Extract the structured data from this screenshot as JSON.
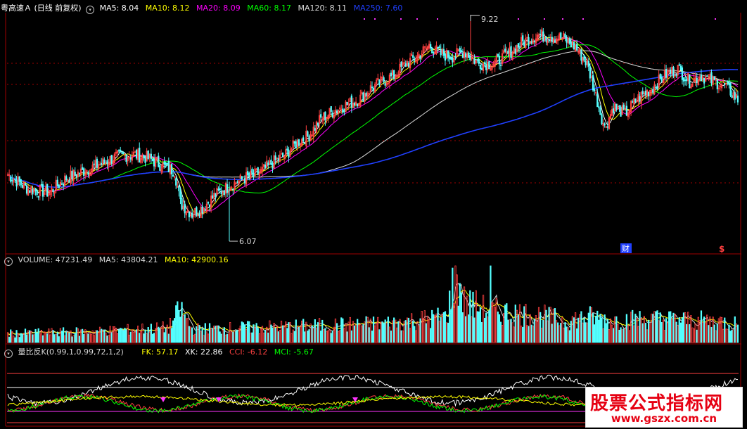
{
  "colors": {
    "background": "#000000",
    "border": "#a00000",
    "up": "#ff4040",
    "down": "#54ffff",
    "ma5": "#ffffff",
    "ma10": "#ffff00",
    "ma20": "#ff00ff",
    "ma60": "#00ff00",
    "ma120": "#dcdcdc",
    "ma250": "#2040ff",
    "label_white": "#d8d8d8",
    "cci": "#ff4040",
    "mci": "#00ff00",
    "fk": "#ffff00",
    "xk": "#ffffff",
    "marker": "#ff33ff"
  },
  "price_panel": {
    "title": "粤高速Ａ (日线 前复权)",
    "collapse_icon": "circle-chevron-icon",
    "indicators": [
      {
        "label": "MA5: 8.04",
        "color": "#ffffff"
      },
      {
        "label": "MA10: 8.12",
        "color": "#ffff00"
      },
      {
        "label": "MA20: 8.09",
        "color": "#ff00ff"
      },
      {
        "label": "MA60: 8.17",
        "color": "#00ff00"
      },
      {
        "label": "MA120: 8.11",
        "color": "#dcdcdc"
      },
      {
        "label": "MA250: 7.60",
        "color": "#2040ff"
      }
    ],
    "high_label": "9.22",
    "low_label": "6.07",
    "markers": [
      {
        "text": "财",
        "color": "#ffffff",
        "bg": "#2040ff"
      },
      {
        "text": "$",
        "color": "#ff4040",
        "bg": ""
      }
    ]
  },
  "volume_panel": {
    "collapse_icon": "circle-chevron-icon",
    "indicators": [
      {
        "label": "VOLUME: 47231.49",
        "color": "#d8d8d8"
      },
      {
        "label": "MA5: 43804.21",
        "color": "#d8d8d8"
      },
      {
        "label": "MA10: 42900.16",
        "color": "#ffff00"
      }
    ]
  },
  "indicator_panel": {
    "title": "量比反K(0.99,1,0.99,72,1,2)",
    "collapse_icon": "circle-chevron-icon",
    "indicators": [
      {
        "label": "FK: 57.17",
        "color": "#ffff00"
      },
      {
        "label": "XK: 22.86",
        "color": "#ffffff"
      },
      {
        "label": "CCI: -6.12",
        "color": "#ff4040"
      },
      {
        "label": "MCI: -5.67",
        "color": "#00ff00"
      }
    ]
  },
  "watermark": {
    "main": "股票公式指标网",
    "url": "www.gszx.com.cn"
  },
  "chart_data": {
    "type": "candlestick",
    "title": "粤高速Ａ (日线 前复权)",
    "price_range": [
      6.07,
      9.22
    ],
    "price_high_label": 9.22,
    "price_low_label": 6.07,
    "last_values": {
      "MA5": 8.04,
      "MA10": 8.12,
      "MA20": 8.09,
      "MA60": 8.17,
      "MA120": 8.11,
      "MA250": 7.6,
      "VOLUME": 47231.49,
      "VOL_MA5": 43804.21,
      "VOL_MA10": 42900.16,
      "FK": 57.17,
      "XK": 22.86,
      "CCI": -6.12,
      "MCI": -5.67
    },
    "close_path": [
      [
        0,
        7.0
      ],
      [
        14,
        6.8
      ],
      [
        28,
        6.75
      ],
      [
        40,
        6.95
      ],
      [
        52,
        7.05
      ],
      [
        64,
        7.15
      ],
      [
        74,
        7.25
      ],
      [
        86,
        7.28
      ],
      [
        96,
        7.23
      ],
      [
        106,
        7.12
      ],
      [
        114,
        7.05
      ],
      [
        118,
        6.6
      ],
      [
        126,
        6.45
      ],
      [
        134,
        6.55
      ],
      [
        142,
        6.72
      ],
      [
        152,
        6.85
      ],
      [
        162,
        6.95
      ],
      [
        172,
        7.02
      ],
      [
        182,
        7.18
      ],
      [
        190,
        7.28
      ],
      [
        198,
        7.45
      ],
      [
        206,
        7.55
      ],
      [
        214,
        7.78
      ],
      [
        222,
        7.88
      ],
      [
        232,
        7.98
      ],
      [
        240,
        8.05
      ],
      [
        248,
        8.2
      ],
      [
        256,
        8.3
      ],
      [
        264,
        8.38
      ],
      [
        272,
        8.55
      ],
      [
        280,
        8.65
      ],
      [
        288,
        8.8
      ],
      [
        296,
        8.68
      ],
      [
        304,
        8.65
      ],
      [
        312,
        8.72
      ],
      [
        322,
        8.55
      ],
      [
        332,
        8.55
      ],
      [
        342,
        8.68
      ],
      [
        352,
        8.85
      ],
      [
        362,
        8.95
      ],
      [
        372,
        8.92
      ],
      [
        380,
        8.9
      ],
      [
        388,
        8.78
      ],
      [
        396,
        8.55
      ],
      [
        402,
        8.1
      ],
      [
        408,
        7.65
      ],
      [
        414,
        7.95
      ],
      [
        422,
        7.85
      ],
      [
        430,
        8.05
      ],
      [
        440,
        8.2
      ],
      [
        450,
        8.4
      ],
      [
        458,
        8.48
      ],
      [
        466,
        8.3
      ],
      [
        474,
        8.38
      ],
      [
        482,
        8.3
      ],
      [
        490,
        8.25
      ],
      [
        499,
        8.04
      ]
    ],
    "volume_path": [
      [
        0,
        0.12
      ],
      [
        60,
        0.15
      ],
      [
        110,
        0.2
      ],
      [
        118,
        0.45
      ],
      [
        126,
        0.18
      ],
      [
        200,
        0.22
      ],
      [
        260,
        0.26
      ],
      [
        300,
        0.35
      ],
      [
        306,
        0.95
      ],
      [
        312,
        0.55
      ],
      [
        330,
        0.42
      ],
      [
        360,
        0.38
      ],
      [
        380,
        0.3
      ],
      [
        400,
        0.35
      ],
      [
        410,
        0.3
      ],
      [
        440,
        0.32
      ],
      [
        470,
        0.3
      ],
      [
        490,
        0.28
      ],
      [
        499,
        0.25
      ]
    ]
  }
}
